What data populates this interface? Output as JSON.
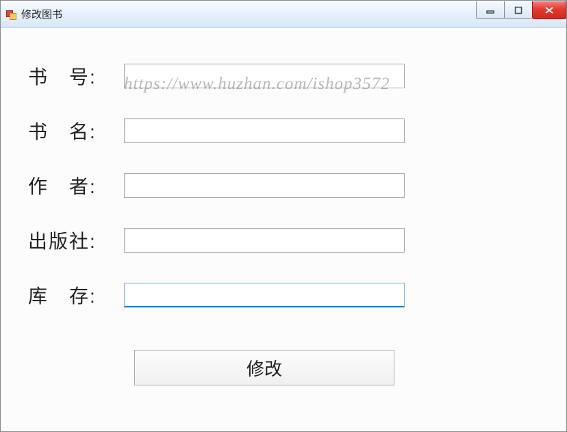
{
  "window": {
    "title": "修改图书"
  },
  "watermark": "https://www.huzhan.com/ishop3572",
  "form": {
    "book_id": {
      "label": "书　号:",
      "value": ""
    },
    "book_name": {
      "label": "书　名:",
      "value": ""
    },
    "author": {
      "label": "作　者:",
      "value": ""
    },
    "publisher": {
      "label": "出版社:",
      "value": ""
    },
    "stock": {
      "label": "库　存:",
      "value": ""
    }
  },
  "buttons": {
    "submit": "修改"
  }
}
